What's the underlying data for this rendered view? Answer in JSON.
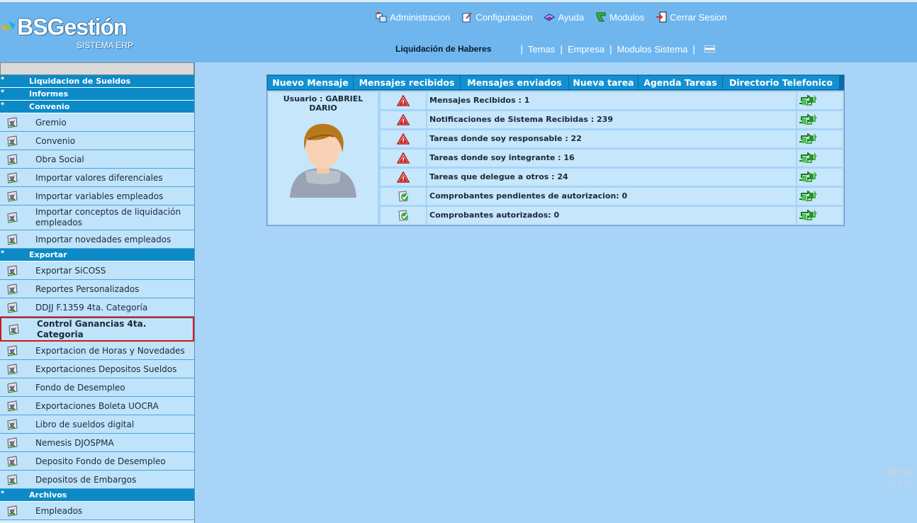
{
  "header": {
    "logo_text": "BSGestión",
    "logo_sub": "SISTEMA ERP",
    "topnav": [
      {
        "label": "Administracion",
        "icon": "admin-icon"
      },
      {
        "label": "Configuracion",
        "icon": "config-icon"
      },
      {
        "label": "Ayuda",
        "icon": "help-icon"
      },
      {
        "label": "Modulos",
        "icon": "modules-icon"
      },
      {
        "label": "Cerrar Sesion",
        "icon": "logout-icon"
      }
    ],
    "current_module": "Liquidación de Haberes",
    "subnav": [
      "Temas",
      "Empresa",
      "Modulos Sistema"
    ]
  },
  "sidebar": {
    "sections": [
      {
        "label": "Liquidacion de Sueldos",
        "items": []
      },
      {
        "label": "Informes",
        "items": []
      },
      {
        "label": "Convenio",
        "items": [
          {
            "label": "Gremio"
          },
          {
            "label": "Convenio"
          },
          {
            "label": "Obra Social"
          },
          {
            "label": "Importar valores diferenciales"
          },
          {
            "label": "Importar variables empleados"
          },
          {
            "label": "Importar conceptos de liquidación empleados",
            "two": true
          },
          {
            "label": "Importar novedades empleados"
          }
        ]
      },
      {
        "label": "Exportar",
        "items": [
          {
            "label": "Exportar SiCOSS"
          },
          {
            "label": "Reportes Personalizados"
          },
          {
            "label": "DDJJ F.1359 4ta. Categoría"
          },
          {
            "label": "Control Ganancias 4ta. Categoria",
            "two": true,
            "selected": true
          },
          {
            "label": "Exportacion de Horas y Novedades"
          },
          {
            "label": "Exportaciones Depositos Sueldos"
          },
          {
            "label": "Fondo de Desempleo"
          },
          {
            "label": "Exportaciones Boleta UOCRA"
          },
          {
            "label": "Libro de sueldos digital"
          },
          {
            "label": "Nemesis DJOSPMA"
          },
          {
            "label": "Deposito Fondo de Desempleo"
          },
          {
            "label": "Depositos de Embargos"
          }
        ]
      },
      {
        "label": "Archivos",
        "items": [
          {
            "label": "Empleados"
          }
        ]
      }
    ]
  },
  "tabs": [
    "Nuevo Mensaje",
    "Mensajes recibidos",
    "Mensajes enviados",
    "Nueva tarea",
    "Agenda Tareas",
    "Directorio Telefonico"
  ],
  "user": {
    "label": "Usuario : GABRIEL DARIO"
  },
  "rows": [
    {
      "text": "Mensajes Recibidos : 1",
      "icon": "warning-icon"
    },
    {
      "text": "Notificaciones de Sistema Recibidas : 239",
      "icon": "warning-icon"
    },
    {
      "text": "Tareas donde soy responsable : 22",
      "icon": "warning-icon"
    },
    {
      "text": "Tareas donde soy integrante : 16",
      "icon": "warning-icon"
    },
    {
      "text": "Tareas que delegue a otros : 24",
      "icon": "warning-icon"
    },
    {
      "text": "Comprobantes pendientes de autorizacion: 0",
      "icon": "check-icon"
    },
    {
      "text": "Comprobantes autorizados: 0",
      "icon": "check-icon"
    }
  ],
  "watermark": {
    "line1": "Activ",
    "line2": "Ve a Co"
  },
  "colors": {
    "header": "#6fb6ef",
    "section": "#0c8ac8",
    "tab": "#1191d2",
    "bg": "#a8d4f8"
  }
}
